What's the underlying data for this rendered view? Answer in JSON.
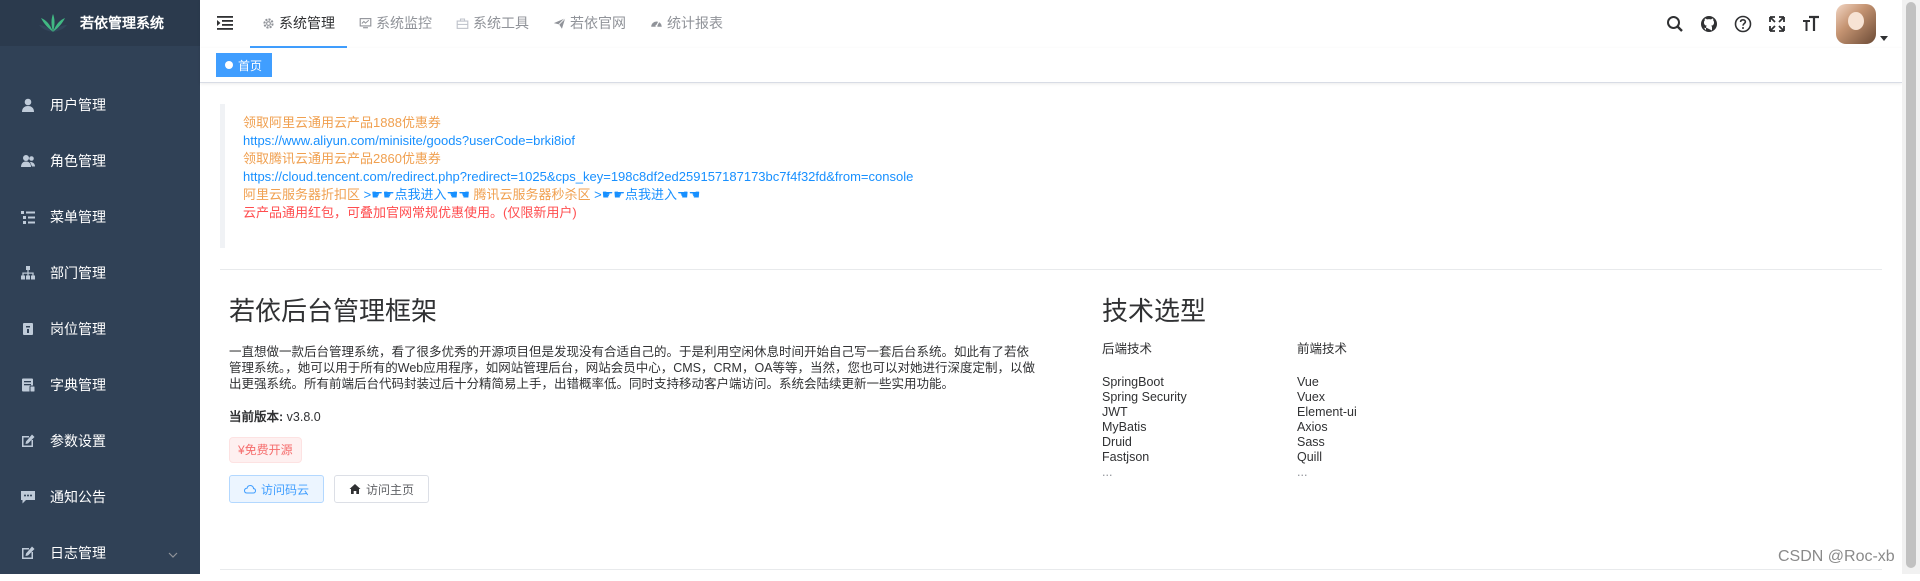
{
  "sidebar": {
    "title": "若依管理系统",
    "items": [
      {
        "label": "用户管理",
        "icon": "user-icon"
      },
      {
        "label": "角色管理",
        "icon": "peoples-icon"
      },
      {
        "label": "菜单管理",
        "icon": "tree-table-icon"
      },
      {
        "label": "部门管理",
        "icon": "tree-icon"
      },
      {
        "label": "岗位管理",
        "icon": "post-icon"
      },
      {
        "label": "字典管理",
        "icon": "dict-icon"
      },
      {
        "label": "参数设置",
        "icon": "edit-icon"
      },
      {
        "label": "通知公告",
        "icon": "message-icon"
      },
      {
        "label": "日志管理",
        "icon": "log-icon"
      }
    ]
  },
  "topnav": {
    "items": [
      {
        "label": "系统管理",
        "icon": "gear-icon",
        "active": true
      },
      {
        "label": "系统监控",
        "icon": "monitor-icon",
        "active": false
      },
      {
        "label": "系统工具",
        "icon": "toolbox-icon",
        "active": false
      },
      {
        "label": "若依官网",
        "icon": "send-icon",
        "active": false
      },
      {
        "label": "统计报表",
        "icon": "dashboard-icon",
        "active": false
      }
    ],
    "tools": [
      "search-icon",
      "github-icon",
      "question-icon",
      "fullscreen-icon",
      "font-size-icon"
    ]
  },
  "tags": {
    "home": "首页"
  },
  "promo": {
    "aliyun_title": "领取阿里云通用云产品1888优惠券",
    "aliyun_url": "https://www.aliyun.com/minisite/goods?userCode=brki8iof",
    "tencent_title": "领取腾讯云通用云产品2860优惠券",
    "tencent_url": "https://cloud.tencent.com/redirect.php?redirect=1025&cps_key=198c8df2ed259157187173bc7f4f32fd&from=console",
    "aliyun_discount": "阿里云服务器折扣区",
    "aliyun_link": ">☛☛点我进入☚☚",
    "tencent_discount": "腾讯云服务器秒杀区",
    "tencent_link": ">☛☛点我进入☚☚",
    "redpack": "云产品通用红包，可叠加官网常规优惠使用。(仅限新用户)"
  },
  "intro": {
    "title": "若依后台管理框架",
    "desc": "一直想做一款后台管理系统，看了很多优秀的开源项目但是发现没有合适自己的。于是利用空闲休息时间开始自己写一套后台系统。如此有了若依管理系统。，她可以用于所有的Web应用程序，如网站管理后台，网站会员中心，CMS，CRM，OA等等，当然，您也可以对她进行深度定制，以做出更强系统。所有前端后台代码封装过后十分精简易上手，出错概率低。同时支持移动客户端访问。系统会陆续更新一些实用功能。",
    "version_label": "当前版本:",
    "version": "v3.8.0",
    "free_tag": "¥免费开源",
    "btn_gitee": "访问码云",
    "btn_home": "访问主页"
  },
  "tech": {
    "title": "技术选型",
    "backend_head": "后端技术",
    "backend": [
      "SpringBoot",
      "Spring Security",
      "JWT",
      "MyBatis",
      "Druid",
      "Fastjson",
      "..."
    ],
    "frontend_head": "前端技术",
    "frontend": [
      "Vue",
      "Vuex",
      "Element-ui",
      "Axios",
      "Sass",
      "Quill",
      "..."
    ]
  },
  "watermark": "CSDN @Roc-xb"
}
